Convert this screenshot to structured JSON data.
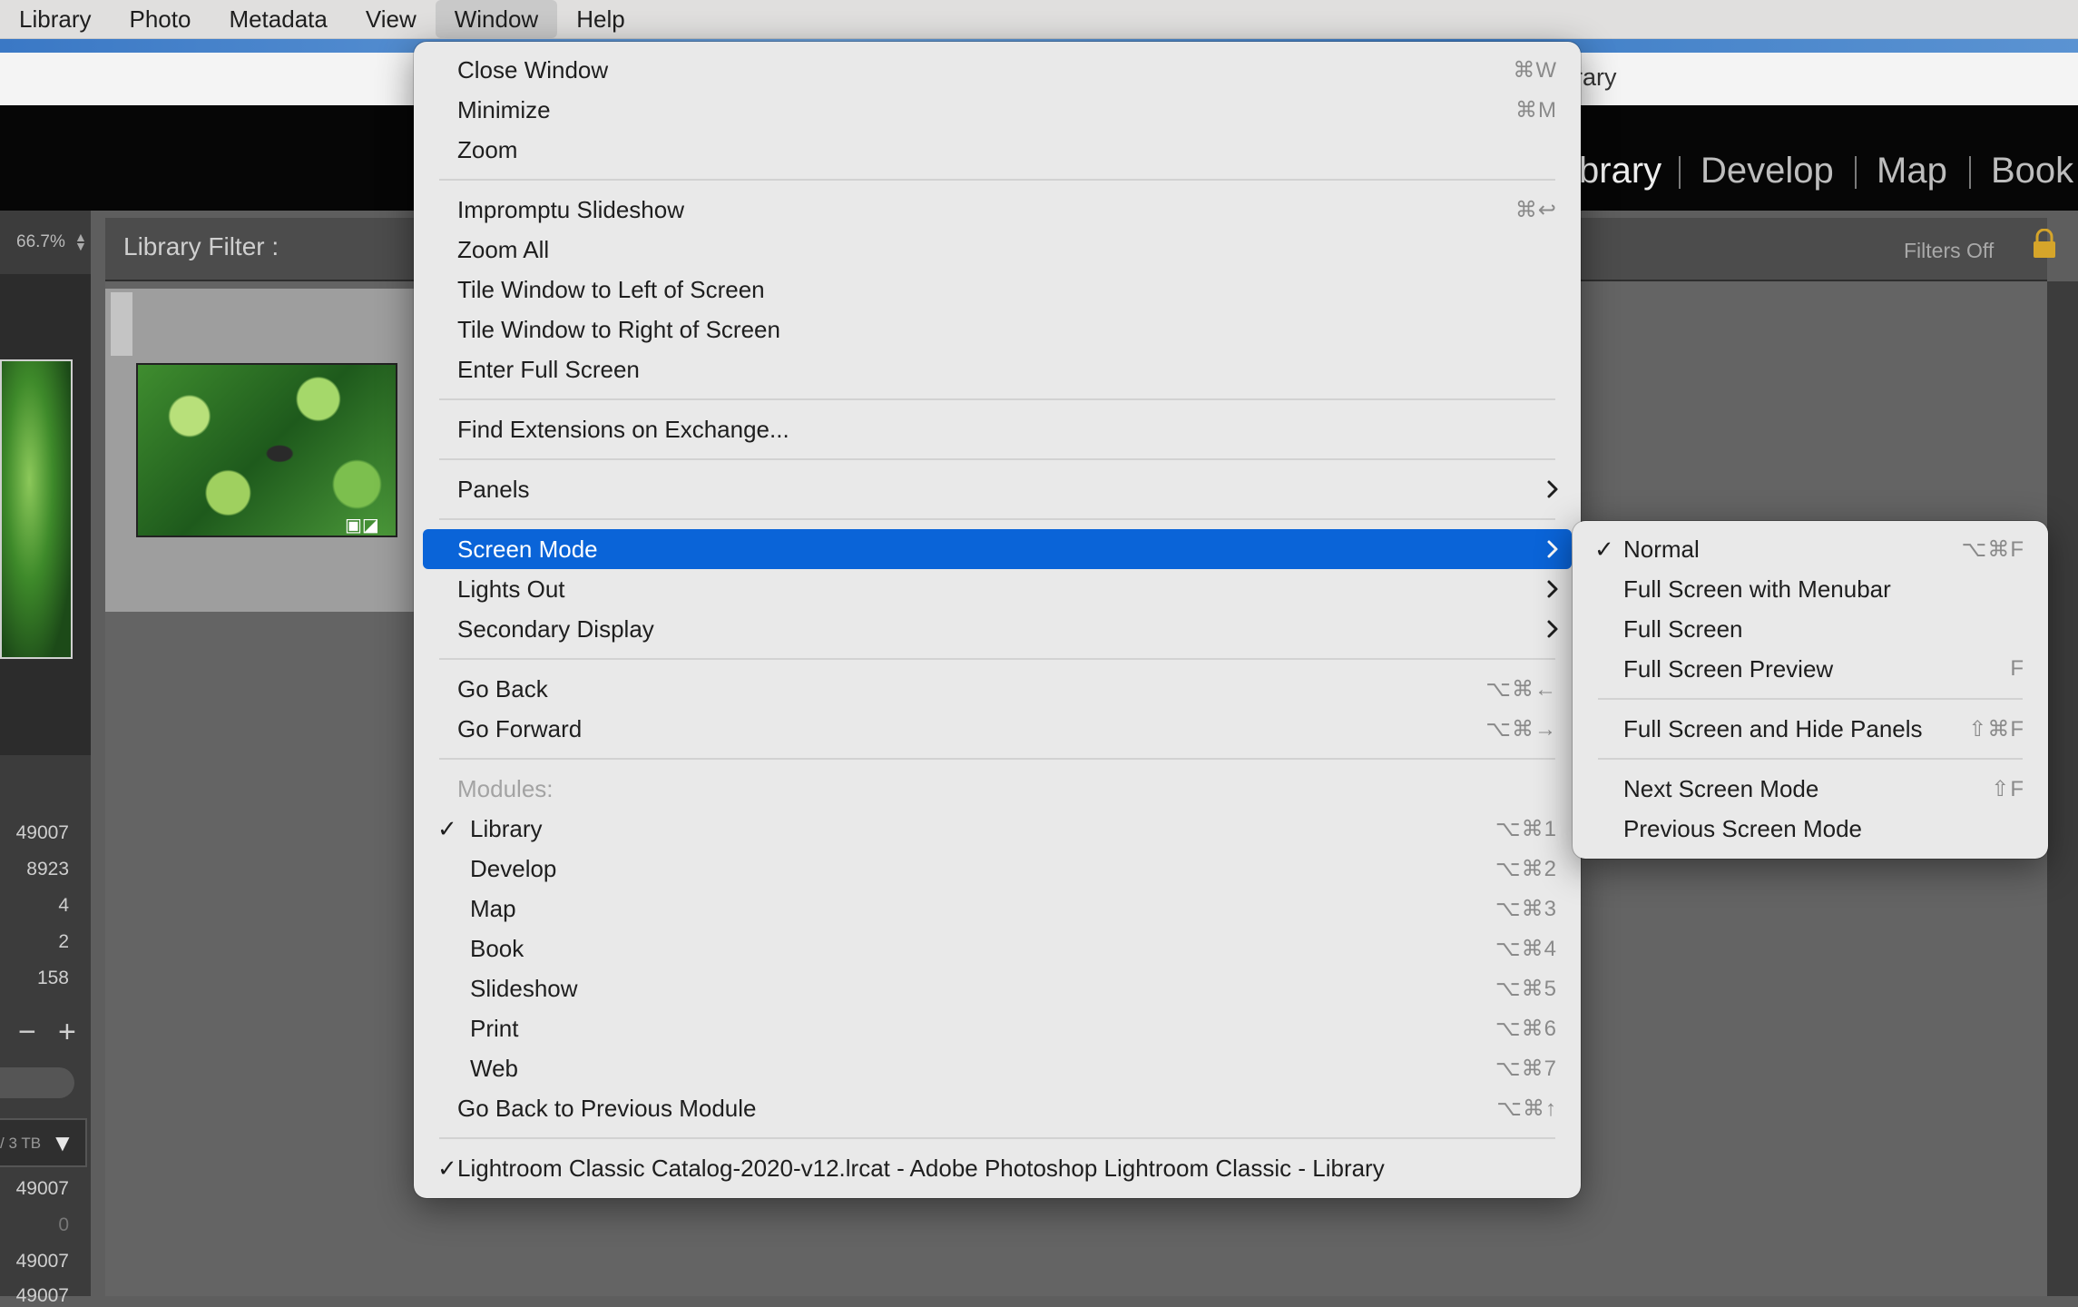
{
  "menubar": {
    "items": [
      "Library",
      "Photo",
      "Metadata",
      "View",
      "Window",
      "Help"
    ],
    "active": "Window"
  },
  "window_title_fragment": "rary",
  "modules": {
    "library_fragment": "brary",
    "develop": "Develop",
    "map": "Map",
    "book": "Book"
  },
  "filter_bar": {
    "label": "Library Filter :",
    "filters_state": "Filters Off",
    "lock_icon": "lock-icon"
  },
  "left_panel": {
    "zoom": "66.7%",
    "counts_top": [
      "49007",
      "8923",
      "4",
      "2",
      "158"
    ],
    "disk_label": "/ 3 TB",
    "counts_bottom": [
      "49007",
      "0",
      "49007",
      "49007"
    ],
    "minus": "−",
    "plus": "+"
  },
  "window_menu": {
    "items": {
      "close_window": {
        "label": "Close Window",
        "shortcut": "⌘W"
      },
      "minimize": {
        "label": "Minimize",
        "shortcut": "⌘M"
      },
      "zoom": {
        "label": "Zoom"
      },
      "impromptu_slideshow": {
        "label": "Impromptu Slideshow",
        "shortcut": "⌘↩"
      },
      "zoom_all": {
        "label": "Zoom All"
      },
      "tile_left": {
        "label": "Tile Window to Left of Screen"
      },
      "tile_right": {
        "label": "Tile Window to Right of Screen"
      },
      "enter_full_screen": {
        "label": "Enter Full Screen"
      },
      "find_extensions": {
        "label": "Find Extensions on Exchange..."
      },
      "panels": {
        "label": "Panels"
      },
      "screen_mode": {
        "label": "Screen Mode"
      },
      "lights_out": {
        "label": "Lights Out"
      },
      "secondary_display": {
        "label": "Secondary Display"
      },
      "go_back": {
        "label": "Go Back",
        "shortcut": "⌥⌘←"
      },
      "go_forward": {
        "label": "Go Forward",
        "shortcut": "⌥⌘→"
      },
      "modules_header": {
        "label": "Modules:"
      },
      "library": {
        "label": "Library",
        "shortcut": "⌥⌘1",
        "check": "✓"
      },
      "develop": {
        "label": "Develop",
        "shortcut": "⌥⌘2"
      },
      "map": {
        "label": "Map",
        "shortcut": "⌥⌘3"
      },
      "book": {
        "label": "Book",
        "shortcut": "⌥⌘4"
      },
      "slideshow": {
        "label": "Slideshow",
        "shortcut": "⌥⌘5"
      },
      "print": {
        "label": "Print",
        "shortcut": "⌥⌘6"
      },
      "web": {
        "label": "Web",
        "shortcut": "⌥⌘7"
      },
      "go_back_module": {
        "label": "Go Back to Previous Module",
        "shortcut": "⌥⌘↑"
      },
      "catalog_window": {
        "label": "Lightroom Classic Catalog-2020-v12.lrcat - Adobe Photoshop Lightroom Classic - Library",
        "check": "✓"
      }
    }
  },
  "screen_mode_submenu": {
    "normal": {
      "label": "Normal",
      "shortcut": "⌥⌘F",
      "check": "✓"
    },
    "full_screen_menubar": {
      "label": "Full Screen with Menubar"
    },
    "full_screen": {
      "label": "Full Screen"
    },
    "full_screen_preview": {
      "label": "Full Screen Preview",
      "shortcut": "F"
    },
    "full_screen_hide_panels": {
      "label": "Full Screen and Hide Panels",
      "shortcut": "⇧⌘F"
    },
    "next_screen_mode": {
      "label": "Next Screen Mode",
      "shortcut": "⇧F"
    },
    "previous_screen_mode": {
      "label": "Previous Screen Mode"
    }
  },
  "colors": {
    "menu_background": "#e9e9e9",
    "highlight": "#0a64d8",
    "app_background": "#5e5e5e"
  }
}
